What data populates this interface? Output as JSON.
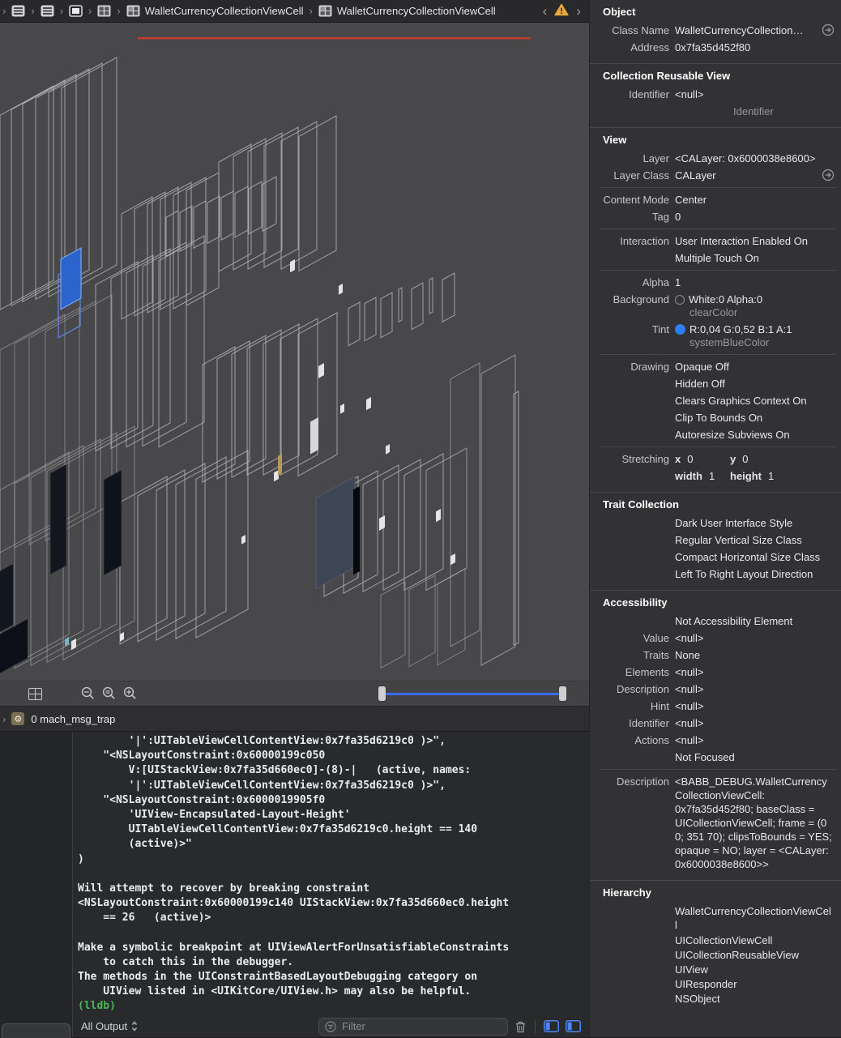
{
  "colors": {
    "annotation_red": "#c23b2d",
    "selection_blue": "#2c64cd",
    "selection_blue_stroke": "#7aa2ea",
    "tint_blue": "#2e7ef7",
    "slider_blue": "#3a6cf0"
  },
  "jumpbar": {
    "items": [
      {
        "icon": "list",
        "label": ""
      },
      {
        "icon": "list",
        "label": ""
      },
      {
        "icon": "window",
        "label": ""
      },
      {
        "icon": "grid",
        "label": ""
      },
      {
        "icon": "gridcell",
        "label": "WalletCurrencyCollectionViewCell"
      },
      {
        "icon": "gridcell",
        "label": "WalletCurrencyCollectionViewCell"
      }
    ],
    "back_label": "‹",
    "forward_label": "›"
  },
  "debug_bar": {
    "chevron": "›",
    "frame_label": "0 mach_msg_trap"
  },
  "console": {
    "lines": [
      {
        "t": "        '|':UITableViewCellContentView:0x7fa35d6219c0 )>\","
      },
      {
        "t": "    \"<NSLayoutConstraint:0x60000199c050"
      },
      {
        "t": "        V:[UIStackView:0x7fa35d660ec0]-(8)-|   (active, names:"
      },
      {
        "t": "        '|':UITableViewCellContentView:0x7fa35d6219c0 )>\","
      },
      {
        "t": "    \"<NSLayoutConstraint:0x6000019905f0"
      },
      {
        "t": "        'UIView-Encapsulated-Layout-Height'"
      },
      {
        "t": "        UITableViewCellContentView:0x7fa35d6219c0.height == 140"
      },
      {
        "t": "        (active)>\""
      },
      {
        "t": ")"
      },
      {
        "t": ""
      },
      {
        "t": "Will attempt to recover by breaking constraint"
      },
      {
        "t": "<NSLayoutConstraint:0x60000199c140 UIStackView:0x7fa35d660ec0.height"
      },
      {
        "t": "    == 26   (active)>"
      },
      {
        "t": ""
      },
      {
        "t": "Make a symbolic breakpoint at UIViewAlertForUnsatisfiableConstraints"
      },
      {
        "t": "    to catch this in the debugger."
      },
      {
        "t": "The methods in the UIConstraintBasedLayoutDebugging category on"
      },
      {
        "t": "    UIView listed in <UIKitCore/UIView.h> may also be helpful."
      },
      {
        "t": "(lldb)",
        "c": "green"
      }
    ]
  },
  "console_bar": {
    "output_selector": "All Output",
    "filter_placeholder": "Filter"
  },
  "inspector": {
    "sections": [
      {
        "id": "object",
        "title": "Object",
        "rows": [
          {
            "label": "Class Name",
            "value": "WalletCurrencyCollection…",
            "arrow": true
          },
          {
            "label": "Address",
            "value": "0x7fa35d452f80"
          }
        ]
      },
      {
        "id": "collection-reusable-view",
        "title": "Collection Reusable View",
        "rows": [
          {
            "label": "Identifier",
            "value": "<null>"
          },
          {
            "label": "",
            "value": "Identifier",
            "grey": true,
            "indent": 72
          }
        ]
      },
      {
        "id": "view",
        "title": "View",
        "rows": [
          {
            "label": "Layer",
            "value": "<CALayer: 0x6000038e8600>"
          },
          {
            "label": "Layer Class",
            "value": "CALayer",
            "arrow": true
          },
          {
            "divider": true
          },
          {
            "label": "Content Mode",
            "value": "Center"
          },
          {
            "label": "Tag",
            "value": "0"
          },
          {
            "divider": true
          },
          {
            "label": "Interaction",
            "value": "User Interaction Enabled On"
          },
          {
            "label": "",
            "value": "Multiple Touch On"
          },
          {
            "divider": true
          },
          {
            "label": "Alpha",
            "value": "1"
          },
          {
            "label": "Background",
            "value": "White:0 Alpha:0",
            "value2": "clearColor",
            "swatch": "empty"
          },
          {
            "label": "Tint",
            "value": "R:0,04 G:0,52 B:1 A:1",
            "value2": "systemBlueColor",
            "swatch": "blue"
          },
          {
            "divider": true
          },
          {
            "label": "Drawing",
            "value": "Opaque Off"
          },
          {
            "label": "",
            "value": "Hidden Off"
          },
          {
            "label": "",
            "value": "Clears Graphics Context On"
          },
          {
            "label": "",
            "value": "Clip To Bounds On"
          },
          {
            "label": "",
            "value": "Autoresize Subviews On"
          },
          {
            "divider": true
          },
          {
            "label": "Stretching",
            "cols": [
              {
                "k": "x",
                "v": "0"
              },
              {
                "k": "y",
                "v": "0"
              }
            ]
          },
          {
            "label": "",
            "cols": [
              {
                "k": "width",
                "v": "1"
              },
              {
                "k": "height",
                "v": "1"
              }
            ]
          }
        ]
      },
      {
        "id": "trait-collection",
        "title": "Trait Collection",
        "rows": [
          {
            "label": "",
            "value": "Dark User Interface Style"
          },
          {
            "label": "",
            "value": "Regular Vertical Size Class"
          },
          {
            "label": "",
            "value": "Compact Horizontal Size Class"
          },
          {
            "label": "",
            "value": "Left To Right Layout Direction"
          }
        ]
      },
      {
        "id": "accessibility",
        "title": "Accessibility",
        "rows": [
          {
            "label": "",
            "value": "Not Accessibility Element"
          },
          {
            "label": "Value",
            "value": "<null>"
          },
          {
            "label": "Traits",
            "value": "None"
          },
          {
            "label": "Elements",
            "value": "<null>"
          },
          {
            "label": "Description",
            "value": "<null>"
          },
          {
            "label": "Hint",
            "value": "<null>"
          },
          {
            "label": "Identifier",
            "value": "<null>"
          },
          {
            "label": "Actions",
            "value": "<null>"
          },
          {
            "label": "",
            "value": "Not Focused"
          },
          {
            "divider": true
          },
          {
            "label": "Description",
            "value": "<BABB_DEBUG.WalletCurrencyCollectionViewCell: 0x7fa35d452f80; baseClass = UICollectionViewCell; frame = (0 0; 351 70); clipsToBounds = YES; opaque = NO; layer = <CALayer: 0x6000038e8600>>",
            "wrap": true
          }
        ]
      },
      {
        "id": "hierarchy",
        "title": "Hierarchy",
        "rows": [
          {
            "label": "",
            "value": "WalletCurrencyCollectionViewCell",
            "wrap": true,
            "tight": true
          },
          {
            "label": "",
            "value": "UICollectionViewCell",
            "tight": true
          },
          {
            "label": "",
            "value": "UICollectionReusableView",
            "tight": true
          },
          {
            "label": "",
            "value": "UIView",
            "tight": true
          },
          {
            "label": "",
            "value": "UIResponder",
            "tight": true
          },
          {
            "label": "",
            "value": "NSObject",
            "tight": true
          }
        ]
      }
    ]
  }
}
